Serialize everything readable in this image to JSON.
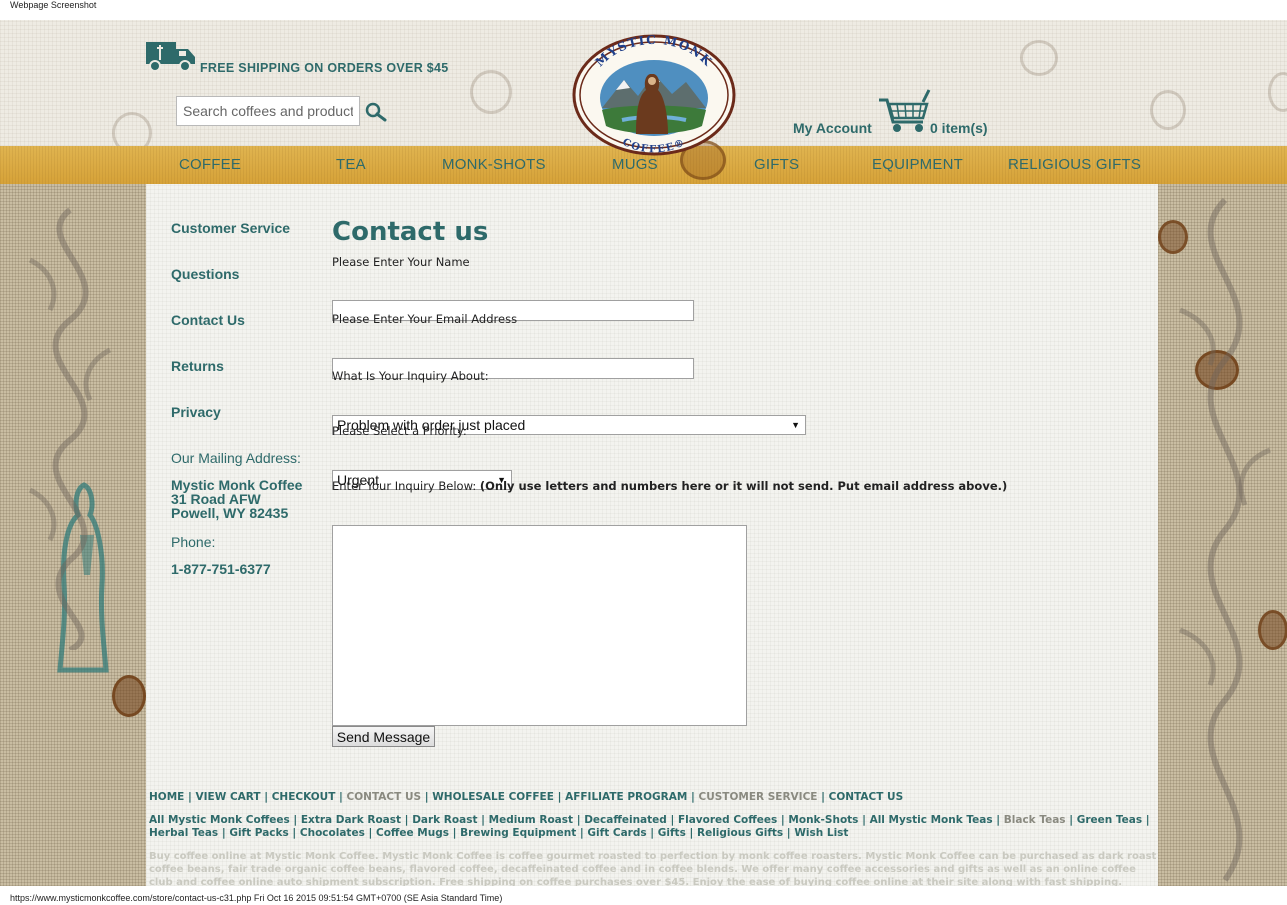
{
  "caption": {
    "top": "Webpage Screenshot",
    "bottom": "https://www.mysticmonkcoffee.com/store/contact-us-c31.php Fri Oct 16 2015 09:51:54 GMT+0700 (SE Asia Standard Time)"
  },
  "header": {
    "shipping_text": "FREE SHIPPING ON ORDERS OVER $45",
    "search_placeholder": "Search coffees and products",
    "logo_top_text": "MYSTIC MONK",
    "logo_bottom_text": "COFFEE®",
    "account_label": "My Account",
    "cart_count": "0 item(s)"
  },
  "nav": {
    "items": [
      "COFFEE",
      "TEA",
      "MONK-SHOTS",
      "MUGS",
      "GIFTS",
      "EQUIPMENT",
      "RELIGIOUS GIFTS"
    ]
  },
  "sidebar": {
    "links": [
      "Customer Service",
      "Questions",
      "Contact Us",
      "Returns",
      "Privacy"
    ],
    "mailing_label": "Our Mailing Address:",
    "address": [
      "Mystic Monk Coffee",
      "31 Road AFW",
      "Powell, WY 82435"
    ],
    "phone_label": "Phone:",
    "phone": "1-877-751-6377"
  },
  "form": {
    "title": "Contact us",
    "name_label": "Please Enter Your Name",
    "email_label": "Please Enter Your Email Address",
    "inquiry_label": "What Is Your Inquiry About:",
    "inquiry_value": "Problem with order just placed",
    "priority_label": "Please Select a Priority:",
    "priority_value": "Urgent",
    "message_label": "Enter Your Inquiry Below:",
    "message_note": "(Only use letters and numbers here or it will not send. Put email address above.)",
    "submit_label": "Send Message"
  },
  "footer": {
    "nav": [
      "HOME",
      "VIEW CART",
      "CHECKOUT",
      "CONTACT US",
      "WHOLESALE COFFEE",
      "AFFILIATE PROGRAM",
      "CUSTOMER SERVICE",
      "CONTACT US"
    ],
    "links": [
      "All Mystic Monk Coffees",
      "Extra Dark Roast",
      "Dark Roast",
      "Medium Roast",
      "Decaffeinated",
      "Flavored Coffees",
      "Monk-Shots",
      "All Mystic Monk Teas",
      "Black Teas",
      "Green Teas",
      "Herbal Teas",
      "Gift Packs",
      "Chocolates",
      "Coffee Mugs",
      "Brewing Equipment",
      "Gift Cards",
      "Gifts",
      "Religious Gifts",
      "Wish List"
    ],
    "blurb": "Buy coffee online at Mystic Monk Coffee. Mystic Monk Coffee is coffee gourmet roasted to perfection by monk coffee roasters. Mystic Monk Coffee can be purchased as dark roast coffee beans, fair trade organic coffee beans, flavored coffee, decaffeinated coffee and in coffee blends. We offer many coffee accessories and gifts as well as an online coffee club and coffee online auto shipment subscription. Free shipping on coffee purchases over $45. Enjoy the ease of buying coffee online at their site along with fast shipping. Enjoy!"
  },
  "colors": {
    "brand_teal": "#2e6a6a",
    "nav_gold": "#d9a43a",
    "burlap": "#c9bda2",
    "content_bg": "#f3f3ef"
  }
}
